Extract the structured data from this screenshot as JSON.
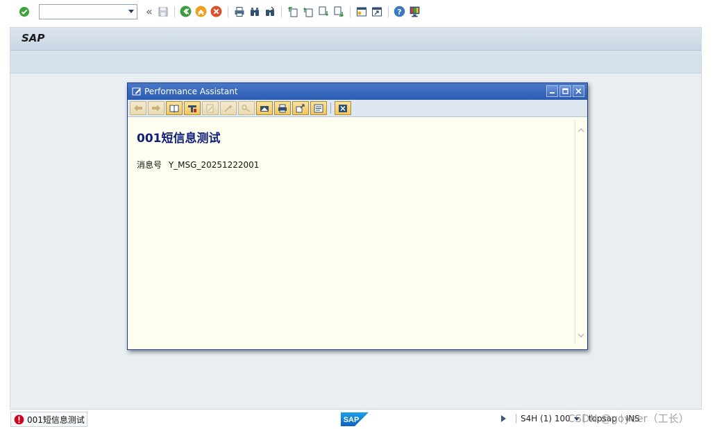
{
  "toolbar": {
    "command_field": {
      "value": "",
      "placeholder": ""
    },
    "back_glyph": "«"
  },
  "frame": {
    "title": "SAP"
  },
  "dialog": {
    "title": "Performance Assistant",
    "message_title": "001短信息测试",
    "message_label": "消息号",
    "message_number": "Y_MSG_20251222001"
  },
  "statusbar": {
    "message": "001短信息测试",
    "system": "S4H (1) 100",
    "server": "topsap",
    "mode": "INS",
    "watermark": "CSDN @goyeer（工长）"
  },
  "colors": {
    "dialog_title_bg": "#2b5bb0",
    "dialog_content_bg": "#fffff0",
    "message_title": "#0f1f7a",
    "frame_bg": "#e9eef3",
    "error_red": "#d0021b",
    "sap_blue": "#0a6ed1"
  }
}
